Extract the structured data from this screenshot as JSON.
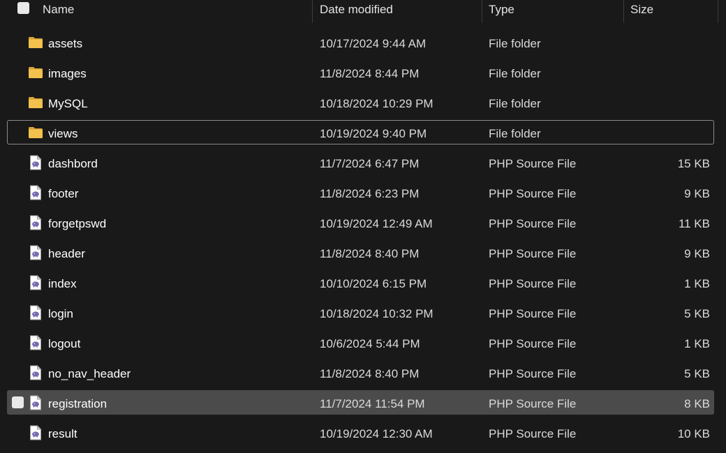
{
  "header": {
    "name": "Name",
    "date_modified": "Date modified",
    "type": "Type",
    "size": "Size"
  },
  "icons": {
    "folder": "folder-icon",
    "php": "php-file-icon",
    "folder_color": "#f2c14e",
    "php_accent": "#7a6bb0"
  },
  "files": [
    {
      "name": "assets",
      "date": "10/17/2024 9:44 AM",
      "type": "File folder",
      "size": "",
      "kind": "folder"
    },
    {
      "name": "images",
      "date": "11/8/2024 8:44 PM",
      "type": "File folder",
      "size": "",
      "kind": "folder"
    },
    {
      "name": "MySQL",
      "date": "10/18/2024 10:29 PM",
      "type": "File folder",
      "size": "",
      "kind": "folder"
    },
    {
      "name": "views",
      "date": "10/19/2024 9:40 PM",
      "type": "File folder",
      "size": "",
      "kind": "folder",
      "focused": true
    },
    {
      "name": "dashbord",
      "date": "11/7/2024 6:47 PM",
      "type": "PHP Source File",
      "size": "15 KB",
      "kind": "php"
    },
    {
      "name": "footer",
      "date": "11/8/2024 6:23 PM",
      "type": "PHP Source File",
      "size": "9 KB",
      "kind": "php"
    },
    {
      "name": "forgetpswd",
      "date": "10/19/2024 12:49 AM",
      "type": "PHP Source File",
      "size": "11 KB",
      "kind": "php"
    },
    {
      "name": "header",
      "date": "11/8/2024 8:40 PM",
      "type": "PHP Source File",
      "size": "9 KB",
      "kind": "php"
    },
    {
      "name": "index",
      "date": "10/10/2024 6:15 PM",
      "type": "PHP Source File",
      "size": "1 KB",
      "kind": "php"
    },
    {
      "name": "login",
      "date": "10/18/2024 10:32 PM",
      "type": "PHP Source File",
      "size": "5 KB",
      "kind": "php"
    },
    {
      "name": "logout",
      "date": "10/6/2024 5:44 PM",
      "type": "PHP Source File",
      "size": "1 KB",
      "kind": "php"
    },
    {
      "name": "no_nav_header",
      "date": "11/8/2024 8:40 PM",
      "type": "PHP Source File",
      "size": "5 KB",
      "kind": "php"
    },
    {
      "name": "registration",
      "date": "11/7/2024 11:54 PM",
      "type": "PHP Source File",
      "size": "8 KB",
      "kind": "php",
      "selected": true
    },
    {
      "name": "result",
      "date": "10/19/2024 12:30 AM",
      "type": "PHP Source File",
      "size": "10 KB",
      "kind": "php"
    }
  ]
}
